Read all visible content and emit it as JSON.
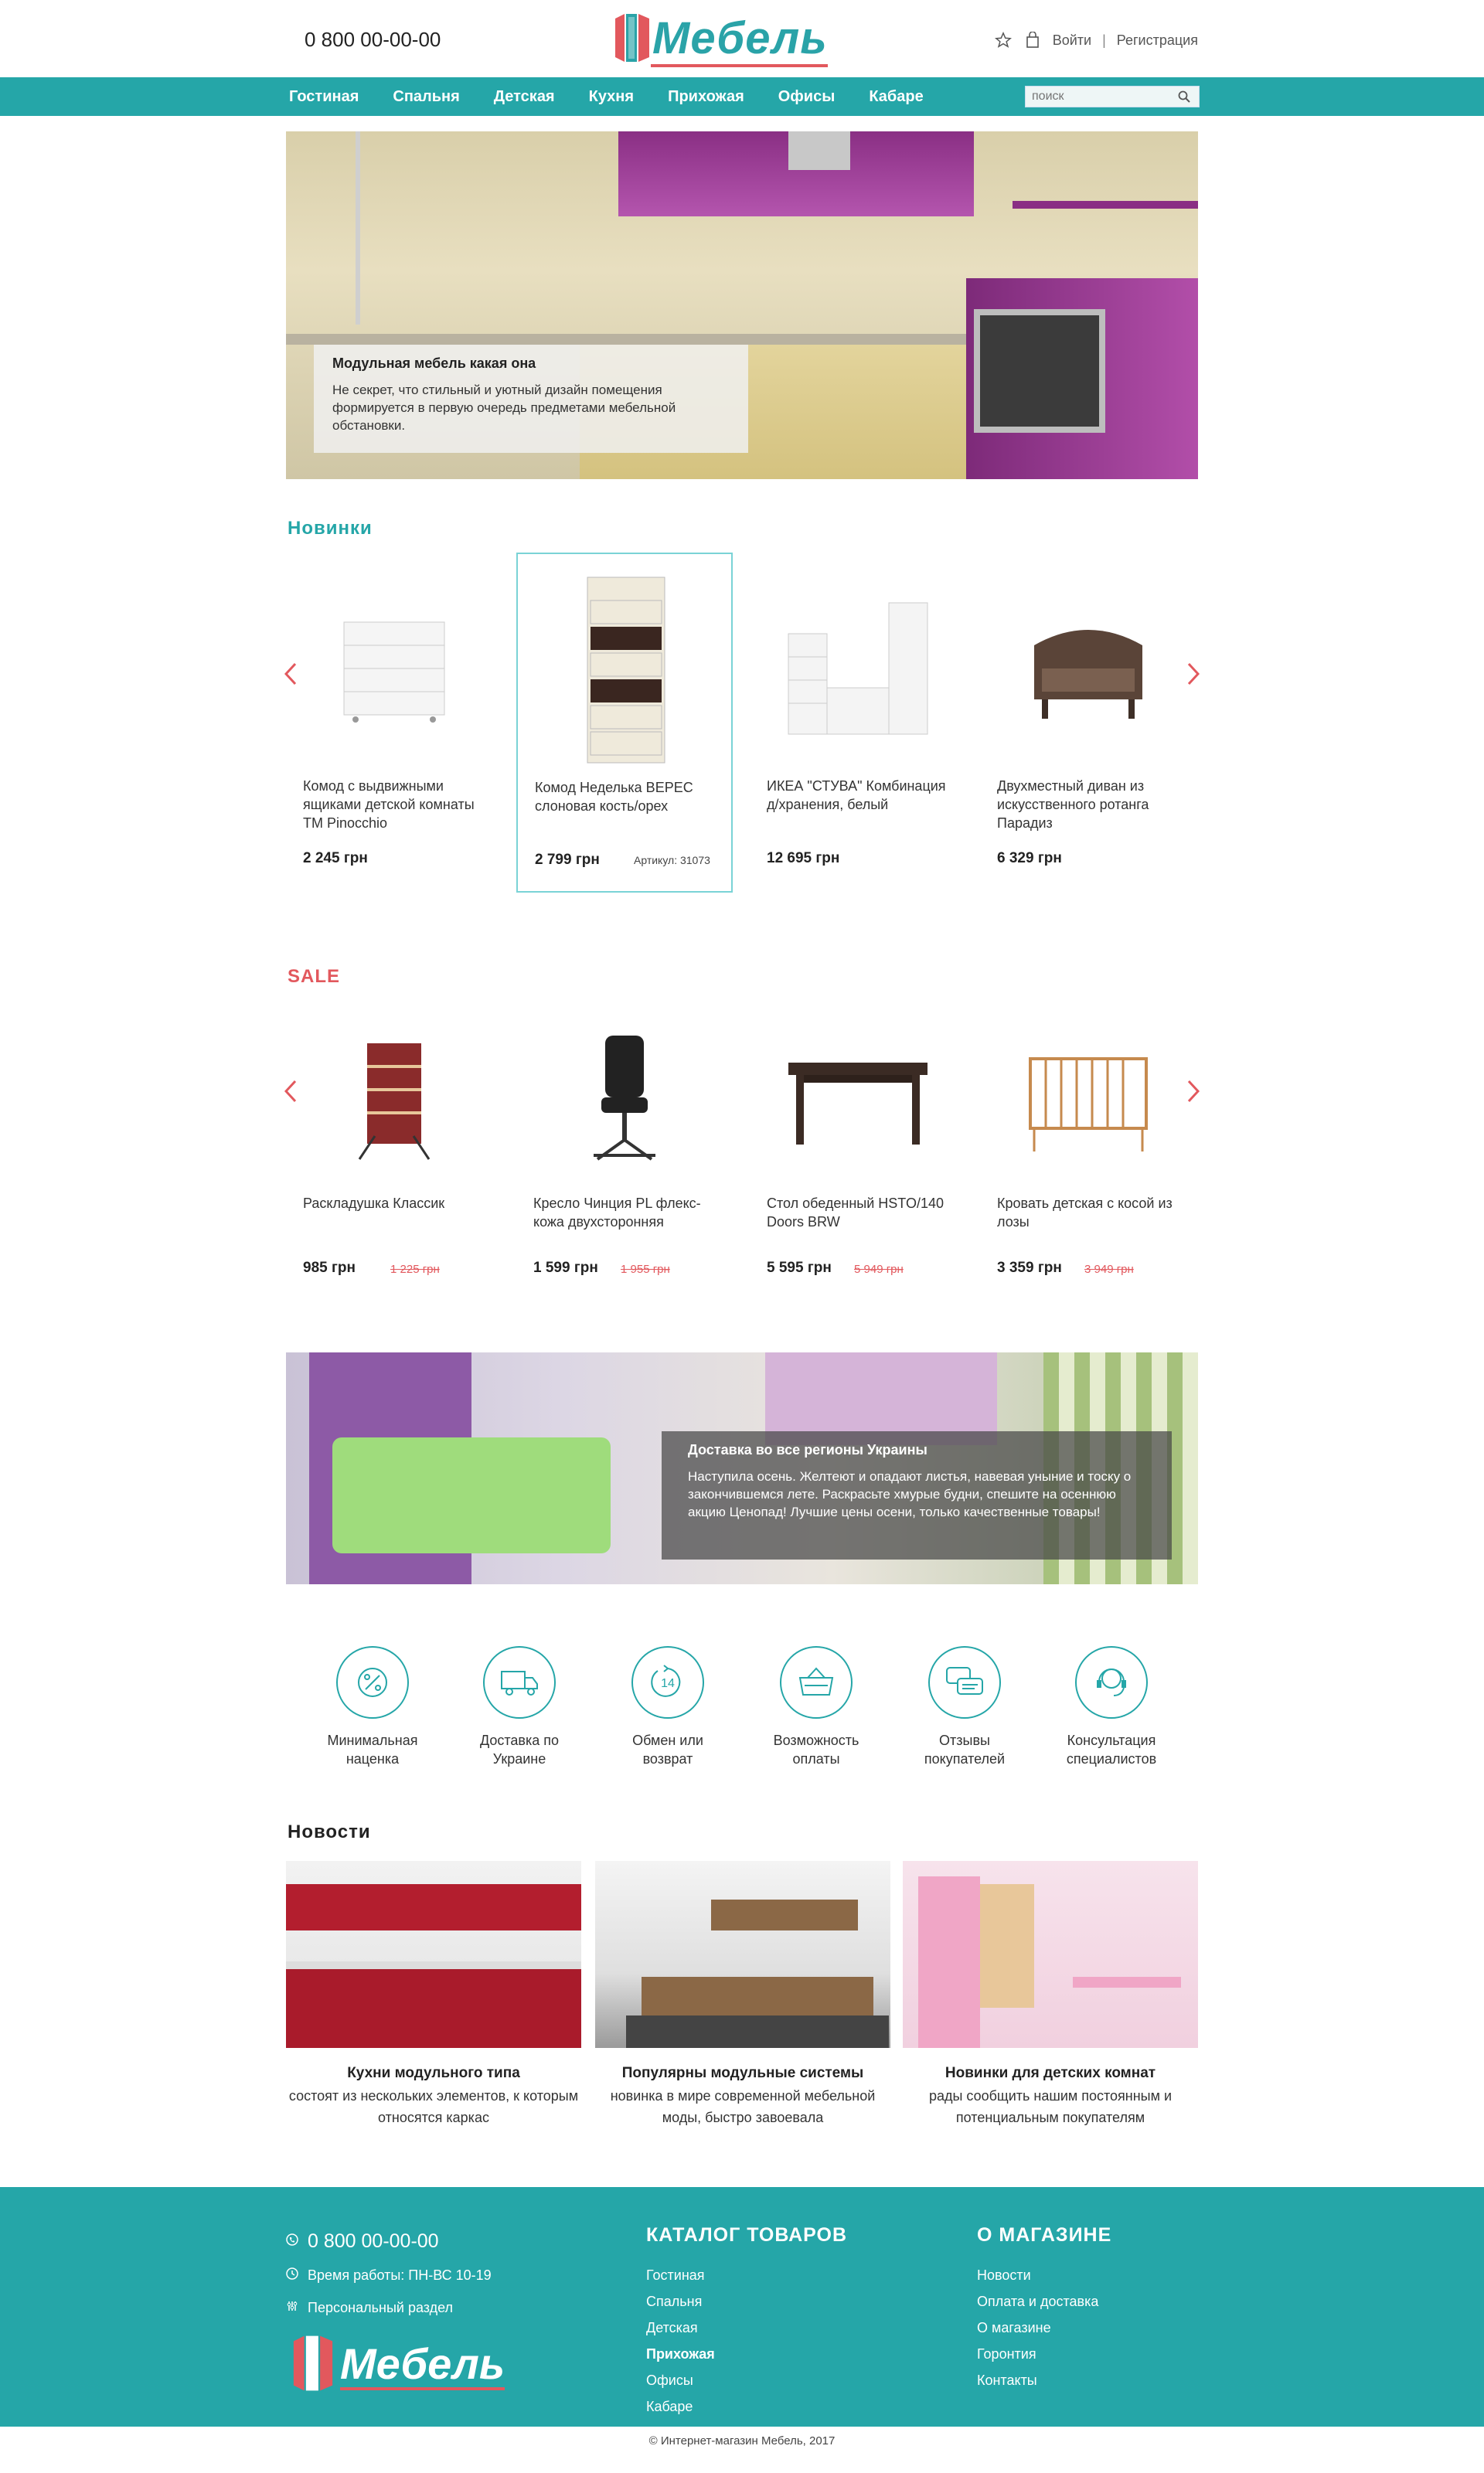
{
  "header": {
    "phone": "0 800 00-00-00",
    "logo_text": "Мебель",
    "login": "Войти",
    "separator": "|",
    "register": "Регистрация"
  },
  "nav": {
    "items": [
      "Гостиная",
      "Спальня",
      "Детская",
      "Кухня",
      "Прихожая",
      "Офисы",
      "Кабаре"
    ],
    "search_placeholder": "поиск"
  },
  "hero": {
    "title": "Модульная мебель какая она",
    "text": "Не секрет, что стильный и уютный дизайн помещения формируется в первую очередь предметами мебельной обстановки."
  },
  "new_items": {
    "title": "Новинки",
    "products": [
      {
        "name": "Комод с выдвижными ящиками детской комнаты ТМ Pinocchio",
        "price": "2 245 грн"
      },
      {
        "name": "Комод Неделька ВЕРЕС слоновая кость/орех",
        "price": "2 799 грн",
        "sku": "Артикул: 31073"
      },
      {
        "name": "ИКЕА \"СТУВА\" Комбинация д/хранения, белый",
        "price": "12 695 грн"
      },
      {
        "name": "Двухместный диван из искусственного ротанга Парадиз",
        "price": "6 329 грн"
      }
    ]
  },
  "sale": {
    "title": "SALE",
    "products": [
      {
        "name": "Раскладушка Классик",
        "price": "985 грн",
        "old_price": "1 225 грн"
      },
      {
        "name": "Кресло Чинция PL флекс-кожа двухсторонняя",
        "price": "1 599 грн",
        "old_price": "1 955 грн"
      },
      {
        "name": "Стол обеденный HSTO/140 Doors BRW",
        "price": "5 595 грн",
        "old_price": "5 949 грн"
      },
      {
        "name": "Кровать детская с косой из лозы",
        "price": "3 359 грн",
        "old_price": "3 949 грн"
      }
    ]
  },
  "banner": {
    "title": "Доставка во все регионы Украины",
    "text": "Наступила осень. Желтеют и опадают листья, навевая уныние и тоску о закончившемся лете. Раскрасьте хмурые будни, спешите на осеннюю акцию Ценопад! Лучшие цены осени, только качественные товары!"
  },
  "features": [
    {
      "icon": "percent-icon",
      "label": "Минимальная наценка"
    },
    {
      "icon": "truck-icon",
      "label": "Доставка по Украине"
    },
    {
      "icon": "return-14-icon",
      "label": "Обмен или возврат"
    },
    {
      "icon": "basket-icon",
      "label": "Возможность оплаты"
    },
    {
      "icon": "chat-icon",
      "label": "Отзывы покупателей"
    },
    {
      "icon": "headset-icon",
      "label": "Консультация специалистов"
    }
  ],
  "news": {
    "title": "Новости",
    "items": [
      {
        "title": "Кухни модульного типа",
        "text": "состоят из нескольких элементов, к которым относятся каркас"
      },
      {
        "title": "Популярны модульные системы",
        "text": "новинка в мире современной мебельной моды, быстро завоевала"
      },
      {
        "title": "Новинки для детских комнат",
        "text": "рады сообщить нашим постоянным и потенциальным покупателям"
      }
    ]
  },
  "footer": {
    "phone": "0 800 00-00-00",
    "hours": "Время работы: ПН-ВС 10-19",
    "personal": "Персональный раздел",
    "catalog_title": "КАТАЛОГ ТОВАРОВ",
    "catalog_links": [
      "Гостиная",
      "Спальня",
      "Детская",
      "Прихожая",
      "Офисы",
      "Кабаре"
    ],
    "about_title": "О МАГАЗИНЕ",
    "about_links": [
      "Новости",
      "Оплата и доставка",
      "О магазине",
      "Горонтия",
      "Контакты"
    ],
    "copyright": "© Интернет-магазин Мебель, 2017"
  },
  "colors": {
    "accent": "#25a6a8",
    "sale": "#e2585d"
  }
}
